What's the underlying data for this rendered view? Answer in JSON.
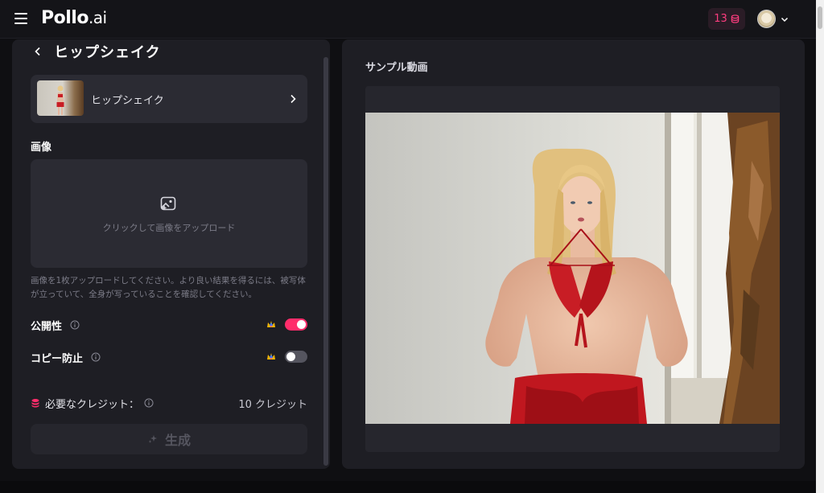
{
  "header": {
    "logo_main": "Pollo",
    "logo_suffix": ".ai",
    "credits": "13"
  },
  "left": {
    "title": "ヒップシェイク",
    "template_name": "ヒップシェイク",
    "image_label": "画像",
    "upload_text": "クリックして画像をアップロード",
    "hint": "画像を1枚アップロードしてください。より良い結果を得るには、被写体が立っていて、全身が写っていることを確認してください。",
    "public_label": "公開性",
    "public_on": true,
    "copy_label": "コピー防止",
    "copy_on": false,
    "credits_label": "必要なクレジット：",
    "credits_value": "10 クレジット",
    "generate_label": "生成"
  },
  "right": {
    "sample_label": "サンプル動画"
  },
  "colors": {
    "accent": "#ff2d6b",
    "panel": "#1e1e24",
    "card": "#2b2b33"
  }
}
